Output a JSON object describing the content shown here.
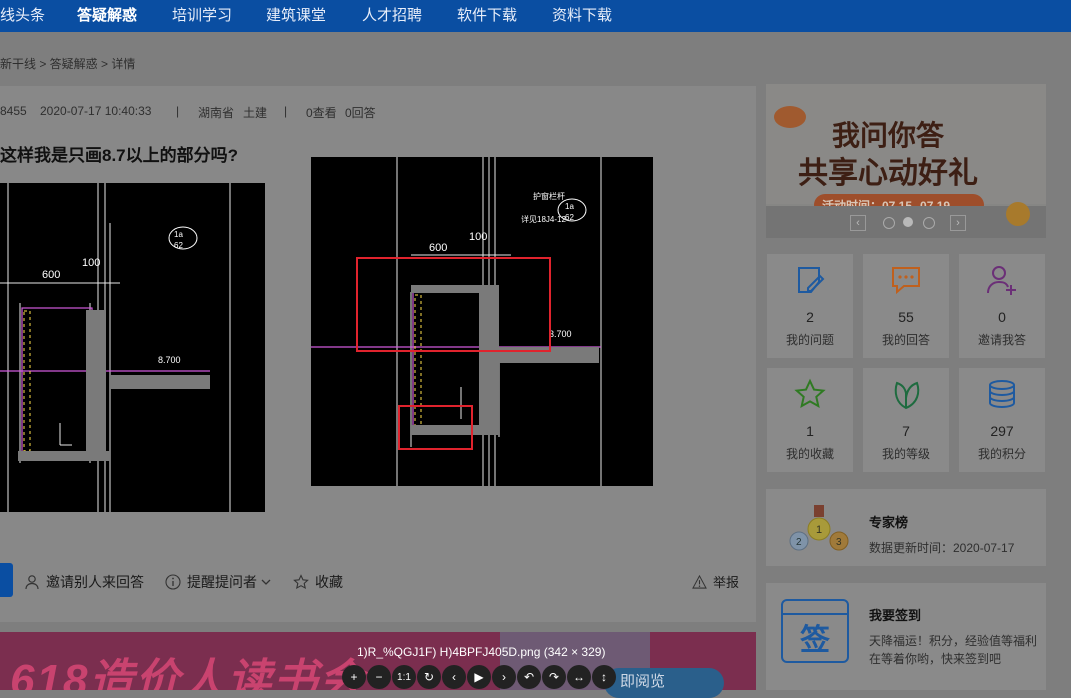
{
  "nav": {
    "items": [
      "线头条",
      "答疑解惑",
      "培训学习",
      "建筑课堂",
      "人才招聘",
      "软件下载",
      "资料下载"
    ],
    "active_index": 1
  },
  "breadcrumb": "新干线 > 答疑解惑 > 详情",
  "question": {
    "user_id": "8455",
    "datetime": "2020-07-17 10:40:33",
    "separator": "|",
    "location": "湖南省",
    "category": "土建",
    "views": "0查看",
    "answers": "0回答",
    "title": "这样我是只画8.7以上的部分吗?"
  },
  "drawing_labels": {
    "dim_600": "600",
    "dim_100": "100",
    "elev": "8.700",
    "elev_right": "3.700",
    "rebar": "护窗栏杆",
    "callout": "详见18J4-12",
    "circle_top": "1a",
    "circle_bottom": "62"
  },
  "actions": {
    "invite": "邀请别人来回答",
    "remind": "提醒提问者",
    "collect": "收藏",
    "report": "举报"
  },
  "promo": {
    "line1": "我问你答",
    "line2": "共享心动好礼",
    "activity": "活动时间：07.15--07.19"
  },
  "stats": [
    {
      "icon": "edit-note-icon",
      "value": "2",
      "label": "我的问题"
    },
    {
      "icon": "chat-bubble-icon",
      "value": "55",
      "label": "我的回答"
    },
    {
      "icon": "add-user-icon",
      "value": "0",
      "label": "邀请我答"
    },
    {
      "icon": "star-icon",
      "value": "1",
      "label": "我的收藏"
    },
    {
      "icon": "leaf-icon",
      "value": "7",
      "label": "我的等级"
    },
    {
      "icon": "coins-icon",
      "value": "297",
      "label": "我的积分"
    }
  ],
  "experts": {
    "title": "专家榜",
    "updated": "数据更新时间：2020-07-17"
  },
  "signin": {
    "title": "我要签到",
    "text": "天降福运！积分，经验值等福利在等着你哟，快来签到吧",
    "icon_char": "签"
  },
  "banner": {
    "text": "618造价人读书会",
    "read_button": "即阅览"
  },
  "viewer": {
    "caption": "1)R_%QGJ1F) H)4BPFJ405D.png (342 × 329)",
    "tools": [
      "+",
      "−",
      "1:1",
      "↻",
      "‹",
      "▶",
      "›",
      "↶",
      "↷",
      "↔",
      "↕"
    ]
  },
  "colors": {
    "nav": "#0a4ea2",
    "accent_blue": "#1e5aa0",
    "highlight_red": "#e0232d",
    "banner": "#7b2e4f"
  }
}
